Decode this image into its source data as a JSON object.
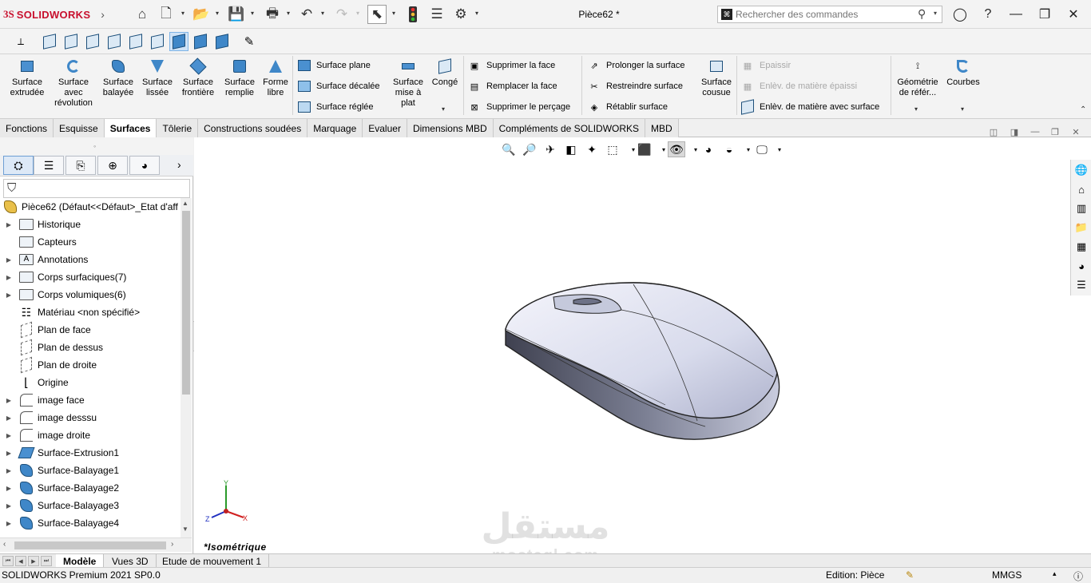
{
  "app": {
    "logo_ds": "3S",
    "logo_name": "SOLIDWORKS",
    "document_title": "Pièce62 *"
  },
  "search": {
    "placeholder": "Rechercher des commandes"
  },
  "ribbon": {
    "surface_extrudee": "Surface extrudée",
    "surface_revolution": "Surface avec révolution",
    "surface_balayee": "Surface balayée",
    "surface_lissee": "Surface lissée",
    "surface_frontiere": "Surface frontière",
    "surface_remplie": "Surface remplie",
    "forme_libre": "Forme libre",
    "surface_plane": "Surface plane",
    "surface_decalee": "Surface décalée",
    "surface_reglee": "Surface réglée",
    "surface_mise_a_plat": "Surface mise à plat",
    "conge": "Congé",
    "supprimer_face": "Supprimer la face",
    "remplacer_face": "Remplacer la face",
    "supprimer_percage": "Supprimer le perçage",
    "prolonger_surface": "Prolonger la surface",
    "restreindre_surface": "Restreindre surface",
    "retablir_surface": "Rétablir surface",
    "surface_cousue": "Surface cousue",
    "epaissir": "Epaissir",
    "enlev_epaissi": "Enlèv. de matière épaissi",
    "enlev_surface": "Enlèv. de matière avec surface",
    "geometrie_reference": "Géométrie de référ...",
    "courbes": "Courbes"
  },
  "tabs": [
    "Fonctions",
    "Esquisse",
    "Surfaces",
    "Tôlerie",
    "Constructions soudées",
    "Marquage",
    "Evaluer",
    "Dimensions MBD",
    "Compléments de SOLIDWORKS",
    "MBD"
  ],
  "active_tab": "Surfaces",
  "tree": {
    "root": "Pièce62  (Défaut<<Défaut>_Etat d'aff",
    "items": [
      "Historique",
      "Capteurs",
      "Annotations",
      "Corps surfaciques(7)",
      "Corps volumiques(6)",
      "Matériau <non spécifié>",
      "Plan de face",
      "Plan de dessus",
      "Plan de droite",
      "Origine",
      "image face",
      "image desssu",
      "image droite",
      "Surface-Extrusion1",
      "Surface-Balayage1",
      "Surface-Balayage2",
      "Surface-Balayage3",
      "Surface-Balayage4"
    ]
  },
  "viewport": {
    "view_name": "*Isométrique",
    "triad_x": "X",
    "triad_y": "Y",
    "triad_z": "Z"
  },
  "bottom_tabs": [
    "Modèle",
    "Vues 3D",
    "Etude de mouvement 1"
  ],
  "status": {
    "version": "SOLIDWORKS Premium 2021 SP0.0",
    "edition": "Edition: Pièce",
    "units": "MMGS"
  },
  "watermark": {
    "arabic": "مستقل",
    "latin": "mostaql.com"
  },
  "colors": {
    "brand": "#c8102e",
    "accent": "#3f87c8",
    "tab_active": "#ffffff"
  }
}
